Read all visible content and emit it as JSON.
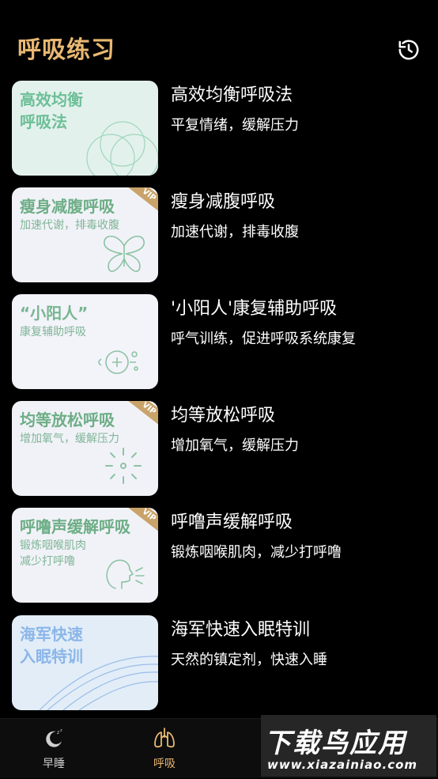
{
  "header": {
    "title": "呼吸练习",
    "history_icon": "history-icon"
  },
  "exercises": [
    {
      "card_title": "高效均衡\n呼吸法",
      "card_sub": "",
      "title": "高效均衡呼吸法",
      "subtitle": "平复情绪，缓解压力",
      "vip": false,
      "bg": "#E3F1EC",
      "accent": "#6DBF97"
    },
    {
      "card_title": "瘦身减腹呼吸",
      "card_sub": "加速代谢，排毒收腹",
      "title": "瘦身减腹呼吸",
      "subtitle": "加速代谢，排毒收腹",
      "vip": true,
      "vip_label": "VIP",
      "bg": "#F1F2F8",
      "accent": "#6DAE86"
    },
    {
      "card_title": "“小阳人”",
      "card_sub": "康复辅助呼吸",
      "title": "'小阳人'康复辅助呼吸",
      "subtitle": "呼气训练，促进呼吸系统康复",
      "vip": false,
      "bg": "#F3F3FA",
      "accent": "#76B690"
    },
    {
      "card_title": "均等放松呼吸",
      "card_sub": "增加氧气，缓解压力",
      "title": "均等放松呼吸",
      "subtitle": "增加氧气，缓解压力",
      "vip": true,
      "vip_label": "VIP",
      "bg": "#F1F2F8",
      "accent": "#6DAE86"
    },
    {
      "card_title": "呼噜声缓解呼吸",
      "card_sub": "锻炼咽喉肌肉\n减少打呼噜",
      "title": "呼噜声缓解呼吸",
      "subtitle": "锻炼咽喉肌肉，减少打呼噜",
      "vip": true,
      "vip_label": "VIP",
      "bg": "#F1F2F8",
      "accent": "#6DAE86"
    },
    {
      "card_title": "海军快速\n入眠特训",
      "card_sub": "",
      "title": "海军快速入眠特训",
      "subtitle": "天然的镇定剂，快速入睡",
      "vip": false,
      "bg": "#E2EDF8",
      "accent": "#8BB6E8"
    }
  ],
  "tabbar": {
    "tabs": [
      {
        "label": "早睡",
        "icon": "moon-icon",
        "active": false
      },
      {
        "label": "呼吸",
        "icon": "lungs-icon",
        "active": true
      },
      {
        "label": "",
        "icon": "",
        "active": false
      }
    ],
    "active_color": "#E8B872",
    "inactive_color": "#CCCCCC"
  },
  "watermark": {
    "main": "下载鸟应用",
    "url": "www.xiazainiao.com"
  }
}
